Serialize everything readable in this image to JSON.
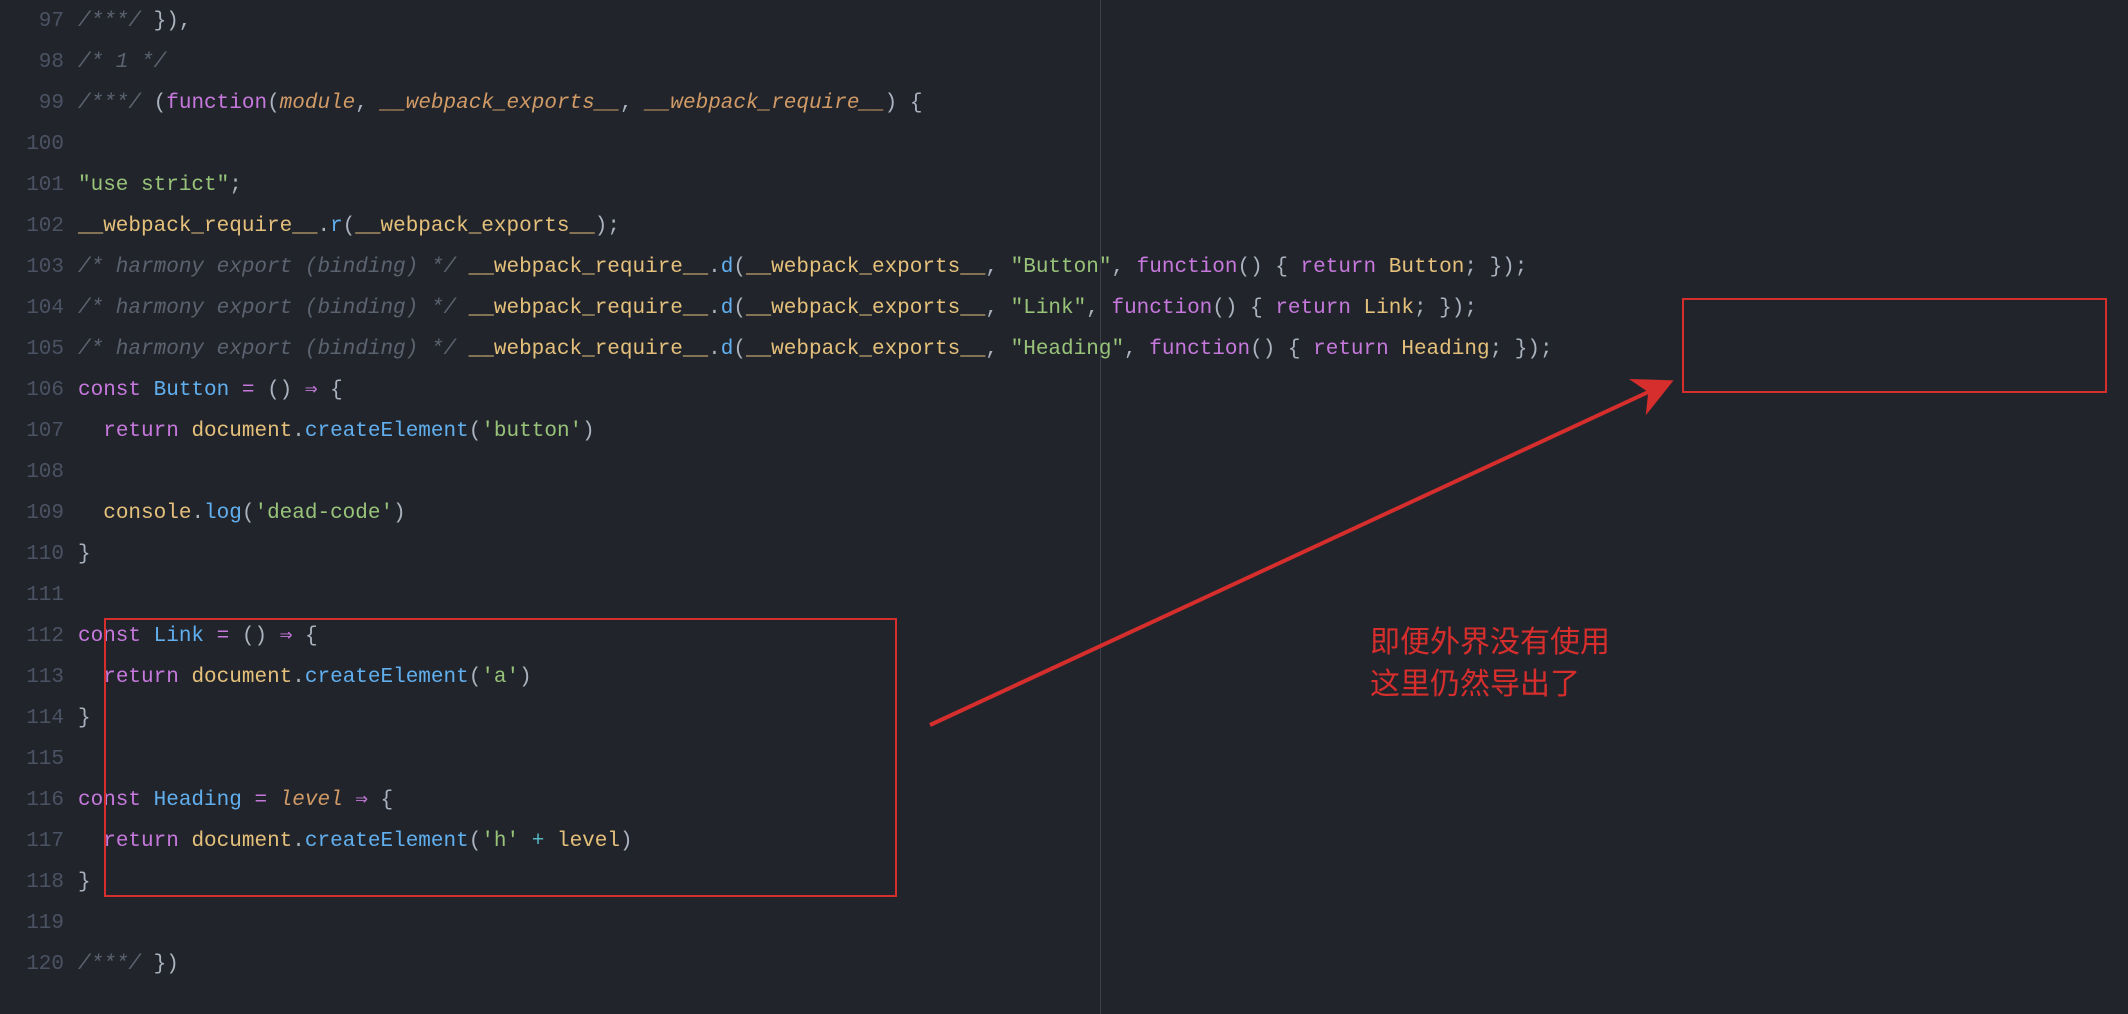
{
  "gutter": {
    "start": 97,
    "end": 120
  },
  "annotation": {
    "line1": "即便外界没有使用",
    "line2": "这里仍然导出了"
  },
  "code": {
    "l97": [
      [
        "cm",
        "/***/"
      ],
      [
        "pl",
        " }),"
      ]
    ],
    "l98": [
      [
        "cm",
        "/* 1 */"
      ]
    ],
    "l99": [
      [
        "cm",
        "/***/"
      ],
      [
        "pl",
        " ("
      ],
      [
        "kw",
        "function"
      ],
      [
        "pl",
        "("
      ],
      [
        "prm",
        "module"
      ],
      [
        "pl",
        ", "
      ],
      [
        "prm",
        "__webpack_exports__"
      ],
      [
        "pl",
        ", "
      ],
      [
        "prm",
        "__webpack_require__"
      ],
      [
        "pl",
        ") {"
      ]
    ],
    "l100": [],
    "l101": [
      [
        "str",
        "\"use strict\""
      ],
      [
        "pl",
        ";"
      ]
    ],
    "l102": [
      [
        "var",
        "__webpack_require__"
      ],
      [
        "pl",
        "."
      ],
      [
        "fn",
        "r"
      ],
      [
        "pl",
        "("
      ],
      [
        "var",
        "__webpack_exports__"
      ],
      [
        "pl",
        ");"
      ]
    ],
    "l103": [
      [
        "cm",
        "/* harmony export (binding) */"
      ],
      [
        "pl",
        " "
      ],
      [
        "var",
        "__webpack_require__"
      ],
      [
        "pl",
        "."
      ],
      [
        "fn",
        "d"
      ],
      [
        "pl",
        "("
      ],
      [
        "var",
        "__webpack_exports__"
      ],
      [
        "pl",
        ", "
      ],
      [
        "str",
        "\"Button\""
      ],
      [
        "pl",
        ", "
      ],
      [
        "kw",
        "function"
      ],
      [
        "pl",
        "() { "
      ],
      [
        "kw",
        "return"
      ],
      [
        "pl",
        " "
      ],
      [
        "var",
        "Button"
      ],
      [
        "pl",
        "; });"
      ]
    ],
    "l104": [
      [
        "cm",
        "/* harmony export (binding) */"
      ],
      [
        "pl",
        " "
      ],
      [
        "var",
        "__webpack_require__"
      ],
      [
        "pl",
        "."
      ],
      [
        "fn",
        "d"
      ],
      [
        "pl",
        "("
      ],
      [
        "var",
        "__webpack_exports__"
      ],
      [
        "pl",
        ", "
      ],
      [
        "str",
        "\"Link\""
      ],
      [
        "pl",
        ", "
      ],
      [
        "kw",
        "function"
      ],
      [
        "pl",
        "() { "
      ],
      [
        "kw",
        "return"
      ],
      [
        "pl",
        " "
      ],
      [
        "var",
        "Link"
      ],
      [
        "pl",
        "; });"
      ]
    ],
    "l105": [
      [
        "cm",
        "/* harmony export (binding) */"
      ],
      [
        "pl",
        " "
      ],
      [
        "var",
        "__webpack_require__"
      ],
      [
        "pl",
        "."
      ],
      [
        "fn",
        "d"
      ],
      [
        "pl",
        "("
      ],
      [
        "var",
        "__webpack_exports__"
      ],
      [
        "pl",
        ", "
      ],
      [
        "str",
        "\"Heading\""
      ],
      [
        "pl",
        ", "
      ],
      [
        "kw",
        "function"
      ],
      [
        "pl",
        "() { "
      ],
      [
        "kw",
        "return"
      ],
      [
        "pl",
        " "
      ],
      [
        "var",
        "Heading"
      ],
      [
        "pl",
        "; });"
      ]
    ],
    "l106": [
      [
        "kw",
        "const"
      ],
      [
        "pl",
        " "
      ],
      [
        "fn",
        "Button"
      ],
      [
        "pl",
        " "
      ],
      [
        "opar",
        "="
      ],
      [
        "pl",
        " () "
      ],
      [
        "opar",
        "⇒"
      ],
      [
        "pl",
        " {"
      ]
    ],
    "l107": [
      [
        "pl",
        "  "
      ],
      [
        "kw",
        "return"
      ],
      [
        "pl",
        " "
      ],
      [
        "var",
        "document"
      ],
      [
        "pl",
        "."
      ],
      [
        "fn",
        "createElement"
      ],
      [
        "pl",
        "("
      ],
      [
        "str",
        "'button'"
      ],
      [
        "pl",
        ")"
      ]
    ],
    "l108": [],
    "l109": [
      [
        "pl",
        "  "
      ],
      [
        "var",
        "console"
      ],
      [
        "pl",
        "."
      ],
      [
        "fn",
        "log"
      ],
      [
        "pl",
        "("
      ],
      [
        "str",
        "'dead-code'"
      ],
      [
        "pl",
        ")"
      ]
    ],
    "l110": [
      [
        "pl",
        "}"
      ]
    ],
    "l111": [],
    "l112": [
      [
        "kw",
        "const"
      ],
      [
        "pl",
        " "
      ],
      [
        "fn",
        "Link"
      ],
      [
        "pl",
        " "
      ],
      [
        "opar",
        "="
      ],
      [
        "pl",
        " () "
      ],
      [
        "opar",
        "⇒"
      ],
      [
        "pl",
        " {"
      ]
    ],
    "l113": [
      [
        "pl",
        "  "
      ],
      [
        "kw",
        "return"
      ],
      [
        "pl",
        " "
      ],
      [
        "var",
        "document"
      ],
      [
        "pl",
        "."
      ],
      [
        "fn",
        "createElement"
      ],
      [
        "pl",
        "("
      ],
      [
        "str",
        "'a'"
      ],
      [
        "pl",
        ")"
      ]
    ],
    "l114": [
      [
        "pl",
        "}"
      ]
    ],
    "l115": [],
    "l116": [
      [
        "kw",
        "const"
      ],
      [
        "pl",
        " "
      ],
      [
        "fn",
        "Heading"
      ],
      [
        "pl",
        " "
      ],
      [
        "opar",
        "="
      ],
      [
        "pl",
        " "
      ],
      [
        "prm2",
        "level"
      ],
      [
        "pl",
        " "
      ],
      [
        "opar",
        "⇒"
      ],
      [
        "pl",
        " {"
      ]
    ],
    "l117": [
      [
        "pl",
        "  "
      ],
      [
        "kw",
        "return"
      ],
      [
        "pl",
        " "
      ],
      [
        "var",
        "document"
      ],
      [
        "pl",
        "."
      ],
      [
        "fn",
        "createElement"
      ],
      [
        "pl",
        "("
      ],
      [
        "str",
        "'h'"
      ],
      [
        "pl",
        " "
      ],
      [
        "op",
        "+"
      ],
      [
        "pl",
        " "
      ],
      [
        "var",
        "level"
      ],
      [
        "pl",
        ")"
      ]
    ],
    "l118": [
      [
        "pl",
        "}"
      ]
    ],
    "l119": [],
    "l120": [
      [
        "cm",
        "/***/"
      ],
      [
        "pl",
        " })"
      ]
    ]
  }
}
